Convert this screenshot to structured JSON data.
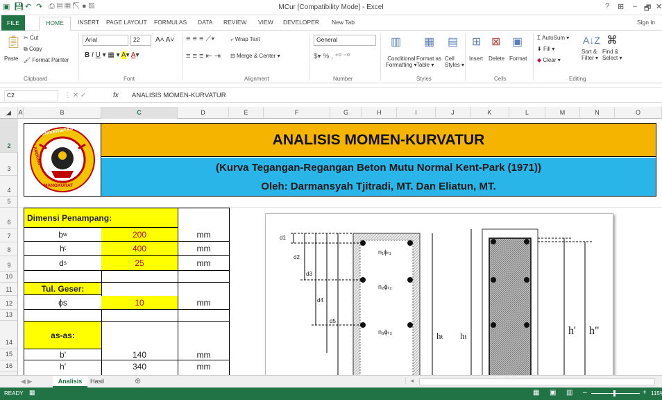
{
  "titlebar": {
    "title": "MCur  [Compatibility Mode] - Excel",
    "help": "?",
    "minimize": "–",
    "restore": "🗗",
    "close": "✕"
  },
  "tabs": [
    "FILE",
    "HOME",
    "INSERT",
    "PAGE LAYOUT",
    "FORMULAS",
    "DATA",
    "REVIEW",
    "VIEW",
    "DEVELOPER",
    "New Tab"
  ],
  "signin": "Sign in",
  "ribbon": {
    "clipboard": {
      "paste": "Paste",
      "cut": "Cut",
      "copy": "Copy",
      "format_painter": "Format Painter",
      "label": "Clipboard"
    },
    "font": {
      "name": "Arial",
      "size": "22",
      "label": "Font"
    },
    "alignment": {
      "wrap": "Wrap Text",
      "merge": "Merge & Center",
      "label": "Alignment"
    },
    "number": {
      "format": "General",
      "label": "Number"
    },
    "styles": {
      "cond": "Conditional",
      "cond2": "Formatting",
      "fmt_table": "Format as",
      "fmt_table2": "Table",
      "cell_styles": "Cell",
      "cell_styles2": "Styles",
      "label": "Styles"
    },
    "cells": {
      "insert": "Insert",
      "delete": "Delete",
      "format": "Format",
      "label": "Cells"
    },
    "editing": {
      "autosum": "AutoSum",
      "fill": "Fill",
      "clear": "Clear",
      "sort": "Sort &",
      "sort2": "Filter",
      "find": "Find &",
      "find2": "Select",
      "label": "Editing"
    }
  },
  "formula_bar": {
    "name_box": "C2",
    "fx": "fx",
    "content": "ANALISIS MOMEN-KURVATUR"
  },
  "columns": [
    "A",
    "B",
    "C",
    "D",
    "E",
    "F",
    "G",
    "H",
    "I",
    "J",
    "K",
    "L",
    "M",
    "N",
    "O"
  ],
  "rows": [
    "2",
    "3",
    "4",
    "5",
    "6",
    "7",
    "8",
    "9",
    "10",
    "11",
    "12",
    "13",
    "14",
    "15",
    "16"
  ],
  "sheet": {
    "title": "ANALISIS MOMEN-KURVATUR",
    "subtitle": "(Kurva Tegangan-Regangan Beton Mutu Normal Kent-Park (1971))",
    "authors": "Oleh: Darmansyah Tjitradi, MT. Dan Eliatun, MT.",
    "logo_top": "UNIVERSITAS",
    "logo_left": "LAMBUNG",
    "logo_bottom": "MANGKURAT",
    "section1": "Dimensi Penampang:",
    "section2": "Tul. Geser:",
    "section3": "as-as:",
    "table": [
      {
        "label": "b",
        "sub": "w",
        "value": "200",
        "unit": "mm"
      },
      {
        "label": "h",
        "sub": "t",
        "value": "400",
        "unit": "mm"
      },
      {
        "label": "d",
        "sub": "s",
        "value": "25",
        "unit": "mm"
      },
      {
        "label": "ϕs",
        "sub": "",
        "value": "10",
        "unit": "mm"
      },
      {
        "label": "b'",
        "sub": "",
        "value": "140",
        "unit": "mm"
      },
      {
        "label": "h'",
        "sub": "",
        "value": "340",
        "unit": "mm"
      }
    ]
  },
  "diagram": {
    "d1": "d1",
    "d2": "d2",
    "d3": "d3",
    "d4": "d4",
    "d5": "d5",
    "n1": "n₁ϕₜ₁",
    "n2": "n₂ϕₜ₂",
    "n3": "n₃ϕₜ₃",
    "ht": "hₜ",
    "ht2": "hₜ",
    "hprime": "h'",
    "hdprime": "h\""
  },
  "sheet_tabs": [
    "Analisis",
    "Hasil"
  ],
  "status": {
    "ready": "READY",
    "zoom": "115%"
  },
  "colors": {
    "excel_green": "#217346",
    "title_yellow": "#f5b400",
    "subtitle_blue": "#29b5e8",
    "input_yellow": "#ffff00"
  }
}
